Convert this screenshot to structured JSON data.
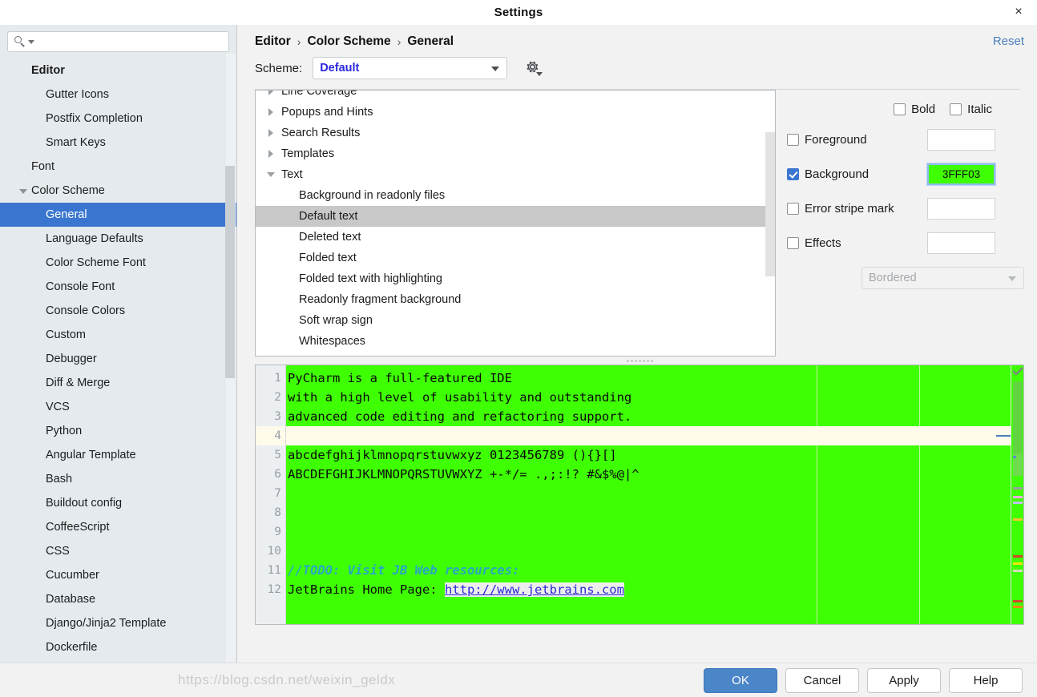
{
  "window": {
    "title": "Settings",
    "close_icon": "close-icon",
    "close_label": "×"
  },
  "sidebar": {
    "search": {
      "value": "",
      "placeholder": "",
      "icon": "search-icon"
    },
    "items": [
      {
        "label": "Editor",
        "level": 0,
        "bold": true,
        "selected": false,
        "twisty": "none"
      },
      {
        "label": "Gutter Icons",
        "level": 1,
        "bold": false,
        "selected": false,
        "twisty": "none"
      },
      {
        "label": "Postfix Completion",
        "level": 1,
        "bold": false,
        "selected": false,
        "twisty": "none"
      },
      {
        "label": "Smart Keys",
        "level": 1,
        "bold": false,
        "selected": false,
        "twisty": "none"
      },
      {
        "label": "Font",
        "level": 11,
        "bold": false,
        "selected": false,
        "twisty": "none"
      },
      {
        "label": "Color Scheme",
        "level": 11,
        "bold": false,
        "selected": false,
        "twisty": "down"
      },
      {
        "label": "General",
        "level": 1,
        "bold": false,
        "selected": true,
        "twisty": "none"
      },
      {
        "label": "Language Defaults",
        "level": 1,
        "bold": false,
        "selected": false,
        "twisty": "none"
      },
      {
        "label": "Color Scheme Font",
        "level": 1,
        "bold": false,
        "selected": false,
        "twisty": "none"
      },
      {
        "label": "Console Font",
        "level": 1,
        "bold": false,
        "selected": false,
        "twisty": "none"
      },
      {
        "label": "Console Colors",
        "level": 1,
        "bold": false,
        "selected": false,
        "twisty": "none"
      },
      {
        "label": "Custom",
        "level": 1,
        "bold": false,
        "selected": false,
        "twisty": "none"
      },
      {
        "label": "Debugger",
        "level": 1,
        "bold": false,
        "selected": false,
        "twisty": "none"
      },
      {
        "label": "Diff & Merge",
        "level": 1,
        "bold": false,
        "selected": false,
        "twisty": "none"
      },
      {
        "label": "VCS",
        "level": 1,
        "bold": false,
        "selected": false,
        "twisty": "none"
      },
      {
        "label": "Python",
        "level": 1,
        "bold": false,
        "selected": false,
        "twisty": "none"
      },
      {
        "label": "Angular Template",
        "level": 1,
        "bold": false,
        "selected": false,
        "twisty": "none"
      },
      {
        "label": "Bash",
        "level": 1,
        "bold": false,
        "selected": false,
        "twisty": "none"
      },
      {
        "label": "Buildout config",
        "level": 1,
        "bold": false,
        "selected": false,
        "twisty": "none"
      },
      {
        "label": "CoffeeScript",
        "level": 1,
        "bold": false,
        "selected": false,
        "twisty": "none"
      },
      {
        "label": "CSS",
        "level": 1,
        "bold": false,
        "selected": false,
        "twisty": "none"
      },
      {
        "label": "Cucumber",
        "level": 1,
        "bold": false,
        "selected": false,
        "twisty": "none"
      },
      {
        "label": "Database",
        "level": 1,
        "bold": false,
        "selected": false,
        "twisty": "none"
      },
      {
        "label": "Django/Jinja2 Template",
        "level": 1,
        "bold": false,
        "selected": false,
        "twisty": "none"
      },
      {
        "label": "Dockerfile",
        "level": 1,
        "bold": false,
        "selected": false,
        "twisty": "none"
      }
    ]
  },
  "content": {
    "breadcrumb": [
      "Editor",
      "Color Scheme",
      "General"
    ],
    "breadcrumb_separator": "›",
    "reset_label": "Reset",
    "scheme_label": "Scheme:",
    "scheme_value": "Default",
    "scheme_gear_icon": "gear-icon"
  },
  "attribute_tree": [
    {
      "label": "Line Coverage",
      "type": "group",
      "expanded": false,
      "selected": false
    },
    {
      "label": "Popups and Hints",
      "type": "group",
      "expanded": false,
      "selected": false
    },
    {
      "label": "Search Results",
      "type": "group",
      "expanded": false,
      "selected": false
    },
    {
      "label": "Templates",
      "type": "group",
      "expanded": false,
      "selected": false
    },
    {
      "label": "Text",
      "type": "group",
      "expanded": true,
      "selected": false
    },
    {
      "label": "Background in readonly files",
      "type": "leaf",
      "expanded": false,
      "selected": false
    },
    {
      "label": "Default text",
      "type": "leaf",
      "expanded": false,
      "selected": true
    },
    {
      "label": "Deleted text",
      "type": "leaf",
      "expanded": false,
      "selected": false
    },
    {
      "label": "Folded text",
      "type": "leaf",
      "expanded": false,
      "selected": false
    },
    {
      "label": "Folded text with highlighting",
      "type": "leaf",
      "expanded": false,
      "selected": false
    },
    {
      "label": "Readonly fragment background",
      "type": "leaf",
      "expanded": false,
      "selected": false
    },
    {
      "label": "Soft wrap sign",
      "type": "leaf",
      "expanded": false,
      "selected": false
    },
    {
      "label": "Whitespaces",
      "type": "leaf",
      "expanded": false,
      "selected": false
    }
  ],
  "attributes": {
    "bold_label": "Bold",
    "bold_checked": false,
    "italic_label": "Italic",
    "italic_checked": false,
    "rows": [
      {
        "label": "Foreground",
        "checked": false,
        "value": "",
        "active": false
      },
      {
        "label": "Background",
        "checked": true,
        "value": "3FFF03",
        "active": true
      },
      {
        "label": "Error stripe mark",
        "checked": false,
        "value": "",
        "active": false
      },
      {
        "label": "Effects",
        "checked": false,
        "value": "",
        "active": false
      }
    ],
    "effects_select_value": "Bordered"
  },
  "preview": {
    "background_color": "#3FFF03",
    "caret_row_color": "#FFFBEB",
    "lines": [
      {
        "n": "1",
        "text": "PyCharm is a full-featured IDE",
        "style": "plain",
        "caret": false
      },
      {
        "n": "2",
        "text": "with a high level of usability and outstanding",
        "style": "plain",
        "caret": false
      },
      {
        "n": "3",
        "text": "advanced code editing and refactoring support.",
        "style": "plain",
        "caret": false
      },
      {
        "n": "4",
        "text": "",
        "style": "plain",
        "caret": true
      },
      {
        "n": "5",
        "text": "abcdefghijklmnopqrstuvwxyz 0123456789 (){}[]",
        "style": "plain",
        "caret": false
      },
      {
        "n": "6",
        "text": "ABCDEFGHIJKLMNOPQRSTUVWXYZ +-*/= .,;:!? #&$%@|^",
        "style": "plain",
        "caret": false
      },
      {
        "n": "7",
        "text": "",
        "style": "plain",
        "caret": false
      },
      {
        "n": "8",
        "text": "",
        "style": "plain",
        "caret": false
      },
      {
        "n": "9",
        "text": "",
        "style": "plain",
        "caret": false
      },
      {
        "n": "10",
        "text": "",
        "style": "plain",
        "caret": false
      },
      {
        "n": "11",
        "text": "//TODO: Visit JB Web resources:",
        "style": "comment",
        "caret": false
      },
      {
        "n": "12",
        "text": "JetBrains Home Page: ",
        "link": "http://www.jetbrains.com",
        "style": "link",
        "caret": false
      }
    ]
  },
  "footer": {
    "buttons": [
      {
        "label": "OK",
        "primary": true
      },
      {
        "label": "Cancel",
        "primary": false
      },
      {
        "label": "Apply",
        "primary": false
      },
      {
        "label": "Help",
        "primary": false
      }
    ],
    "watermark": "https://blog.csdn.net/weixin_geldx"
  }
}
